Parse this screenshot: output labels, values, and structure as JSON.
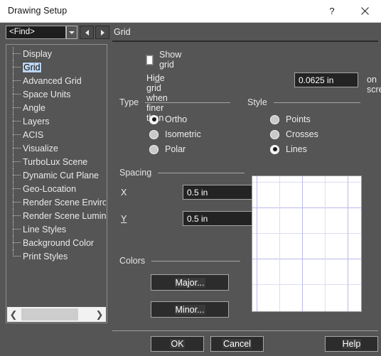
{
  "window": {
    "title": "Drawing Setup",
    "help_icon": "question-mark-icon",
    "close_icon": "close-icon"
  },
  "findbar": {
    "value": "<Find>",
    "dropdown_icon": "chevron-down-icon",
    "prev_icon": "triangle-left-icon",
    "next_icon": "triangle-right-icon"
  },
  "page": {
    "title": "Grid"
  },
  "tree": {
    "items": [
      {
        "label": "Display",
        "selected": false
      },
      {
        "label": "Grid",
        "selected": true
      },
      {
        "label": "Advanced Grid",
        "selected": false
      },
      {
        "label": "Space Units",
        "selected": false
      },
      {
        "label": "Angle",
        "selected": false
      },
      {
        "label": "Layers",
        "selected": false
      },
      {
        "label": "ACIS",
        "selected": false
      },
      {
        "label": "Visualize",
        "selected": false
      },
      {
        "label": "TurboLux Scene",
        "selected": false
      },
      {
        "label": "Dynamic Cut Plane",
        "selected": false
      },
      {
        "label": "Geo-Location",
        "selected": false
      },
      {
        "label": "Render Scene Environment",
        "selected": false
      },
      {
        "label": "Render Scene Luminance",
        "selected": false
      },
      {
        "label": "Line Styles",
        "selected": false
      },
      {
        "label": "Background Color",
        "selected": false
      },
      {
        "label": "Print Styles",
        "selected": false
      }
    ],
    "scroll_left_icon": "chevron-left-icon",
    "scroll_right_icon": "chevron-right-icon"
  },
  "grid": {
    "show_grid_label": "Show grid",
    "show_grid_checked": false,
    "hide_grid_label_pre": "Hi",
    "hide_grid_label_accel": "d",
    "hide_grid_label_post": "e grid when finer than",
    "hide_grid_value": "0.0625 in",
    "on_screen_label": "on screen",
    "type": {
      "header": "Type",
      "options": [
        {
          "label": "Ortho",
          "selected": true
        },
        {
          "label": "Isometric",
          "selected": false
        },
        {
          "label": "Polar",
          "selected": false
        }
      ]
    },
    "style": {
      "header": "Style",
      "options": [
        {
          "label": "Points",
          "selected": false
        },
        {
          "label": "Crosses",
          "selected": false
        },
        {
          "label": "Lines",
          "selected": true
        }
      ]
    },
    "spacing": {
      "header": "Spacing",
      "x_label": "X",
      "x_value": "0.5 in",
      "y_label": "Y",
      "y_value": "0.5 in"
    },
    "colors": {
      "header": "Colors",
      "major_label": "Major...",
      "minor_label": "Minor..."
    },
    "preview": {
      "background": "#ffffff",
      "minor_color": "#dcdcf5",
      "major_color": "#b9b9ec"
    }
  },
  "footer": {
    "ok_label": "OK",
    "cancel_label": "Cancel",
    "help_label": "Help"
  }
}
